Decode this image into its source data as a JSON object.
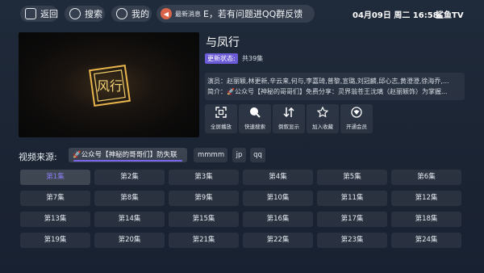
{
  "topbar": {
    "back_label": "返回",
    "search_label": "搜索",
    "mine_label": "我的",
    "notice_tag": "最新消息",
    "notice_text": "E，若有问题进QQ群反馈",
    "clock": "04月09日 周二 16:58",
    "brand": "鲨鱼TV"
  },
  "detail": {
    "title": "与凤行",
    "poster_logo": "风行",
    "status_label": "更新状态:",
    "status_value": "共39集",
    "cast_line": "演员：赵丽颖,林更新,辛云来,何与,李嘉琦,普黎,宣璐,刘冠麟,邱心志,黄澄澄,徐海乔,...",
    "intro_line": "简介：🚀公众号【神秘的哥哥们】免费分享：灵界翁苍王沈璃（赵丽颖饰）为掌握..."
  },
  "actions": [
    {
      "label": "全屏播放",
      "icon": "fullscreen-icon"
    },
    {
      "label": "快速搜索",
      "icon": "search-icon"
    },
    {
      "label": "倒叙显示",
      "icon": "sort-icon"
    },
    {
      "label": "加入收藏",
      "icon": "star-icon"
    },
    {
      "label": "开通会员",
      "icon": "vip-icon"
    }
  ],
  "sources": {
    "label": "视频来源:",
    "items": [
      "🚀公众号【神秘的哥哥们】防失联",
      "mmmm",
      "jp",
      "qq"
    ],
    "active_index": 0
  },
  "episodes": {
    "items": [
      "第1集",
      "第2集",
      "第3集",
      "第4集",
      "第5集",
      "第6集",
      "第7集",
      "第8集",
      "第9集",
      "第10集",
      "第11集",
      "第12集",
      "第13集",
      "第14集",
      "第15集",
      "第16集",
      "第17集",
      "第18集",
      "第19集",
      "第20集",
      "第21集",
      "第22集",
      "第23集",
      "第24集"
    ],
    "active_index": 0
  },
  "colors": {
    "accent": "#7a66e8",
    "status_tag": "#6b5bd6",
    "background": "#1c2534"
  }
}
